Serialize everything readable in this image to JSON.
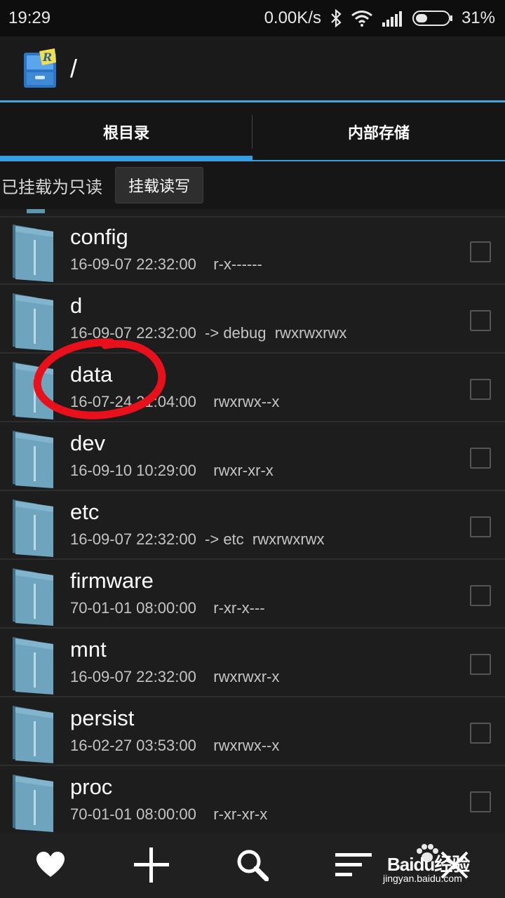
{
  "status_bar": {
    "time": "19:29",
    "net_speed": "0.00K/s",
    "battery": "31%",
    "icons": [
      "bluetooth-icon",
      "wifi-icon",
      "signal-icon",
      "battery-icon"
    ]
  },
  "app_bar": {
    "path": "/",
    "icon": "root-explorer-logo"
  },
  "tabs": [
    {
      "label": "根目录",
      "active": true
    },
    {
      "label": "内部存储",
      "active": false
    }
  ],
  "mount": {
    "status": "已挂载为只读",
    "button": "挂载读写"
  },
  "files": [
    {
      "name": "config",
      "meta": "16-09-07 22:32:00    r-x------"
    },
    {
      "name": "d",
      "meta": "16-09-07 22:32:00  -> debug  rwxrwxrwx"
    },
    {
      "name": "data",
      "meta": "16-07-24 21:04:00    rwxrwx--x"
    },
    {
      "name": "dev",
      "meta": "16-09-10 10:29:00    rwxr-xr-x"
    },
    {
      "name": "etc",
      "meta": "16-09-07 22:32:00  -> etc  rwxrwxrwx"
    },
    {
      "name": "firmware",
      "meta": "70-01-01 08:00:00    r-xr-x---"
    },
    {
      "name": "mnt",
      "meta": "16-09-07 22:32:00    rwxrwxr-x"
    },
    {
      "name": "persist",
      "meta": "16-02-27 03:53:00    rwxrwx--x"
    },
    {
      "name": "proc",
      "meta": "70-01-01 08:00:00    r-xr-xr-x"
    }
  ],
  "bottom_bar": [
    "heart-icon",
    "plus-icon",
    "search-icon",
    "sort-icon",
    "close-icon"
  ],
  "watermark": {
    "main": "Baidu经验",
    "sub": "jingyan.baidu.com"
  },
  "colors": {
    "accent": "#35a0dd",
    "annotation": "#e8101a",
    "folder": "#6fa4bf"
  }
}
